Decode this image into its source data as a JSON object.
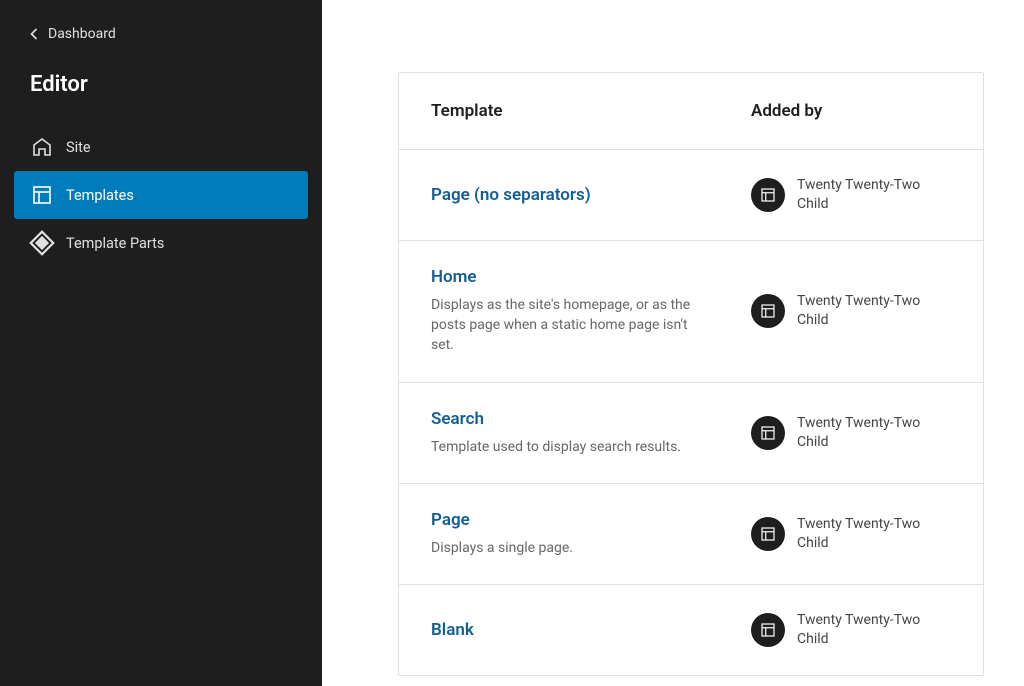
{
  "sidebar": {
    "back_label": "Dashboard",
    "title": "Editor",
    "nav": [
      {
        "label": "Site"
      },
      {
        "label": "Templates"
      },
      {
        "label": "Template Parts"
      }
    ]
  },
  "table": {
    "header": {
      "template": "Template",
      "added_by": "Added by"
    },
    "rows": [
      {
        "name": "Page (no separators)",
        "desc": "",
        "added_by": "Twenty Twenty-Two Child"
      },
      {
        "name": "Home",
        "desc": "Displays as the site's homepage, or as the posts page when a static home page isn't set.",
        "added_by": "Twenty Twenty-Two Child"
      },
      {
        "name": "Search",
        "desc": "Template used to display search results.",
        "added_by": "Twenty Twenty-Two Child"
      },
      {
        "name": "Page",
        "desc": "Displays a single page.",
        "added_by": "Twenty Twenty-Two Child"
      },
      {
        "name": "Blank",
        "desc": "",
        "added_by": "Twenty Twenty-Two Child"
      }
    ]
  }
}
